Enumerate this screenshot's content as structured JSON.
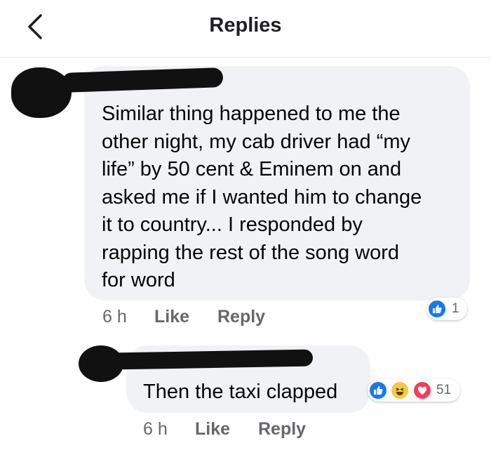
{
  "header": {
    "title": "Replies"
  },
  "comment": {
    "lines": [
      "Similar thing happened to me the",
      "other night, my cab driver had “my",
      "life” by 50 cent & Eminem on and",
      "asked me if I wanted him to change",
      "it to country... I responded by",
      "rapping the rest of the song word",
      "for word"
    ],
    "time": "6 h",
    "like_label": "Like",
    "reply_label": "Reply",
    "reaction_count": "1",
    "reaction_icons": [
      "like-icon"
    ]
  },
  "reply": {
    "text": "Then the taxi clapped",
    "time": "6 h",
    "like_label": "Like",
    "reply_label": "Reply",
    "reaction_count": "51",
    "reaction_icons": [
      "like-icon",
      "haha-icon",
      "love-icon"
    ]
  },
  "colors": {
    "like_blue": "#1877f2",
    "haha_yellow": "#f7c844",
    "love_red": "#f33e58"
  }
}
